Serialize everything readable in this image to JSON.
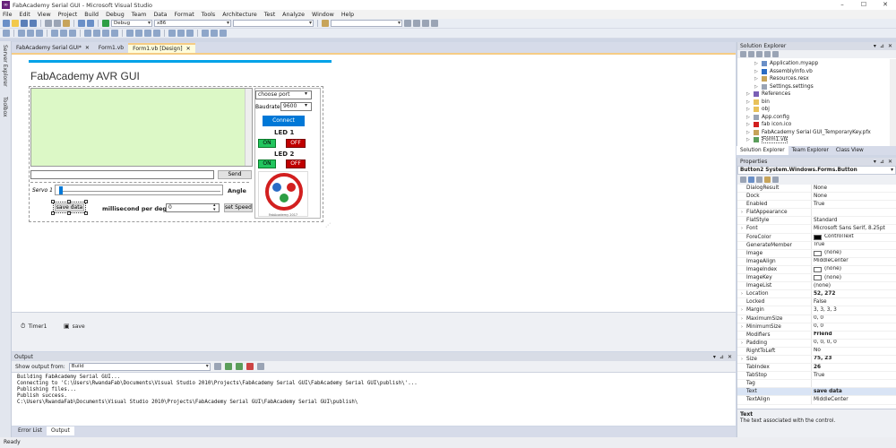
{
  "window": {
    "title": "FabAcademy Serial GUI - Microsoft Visual Studio"
  },
  "menu": [
    "File",
    "Edit",
    "View",
    "Project",
    "Build",
    "Debug",
    "Team",
    "Data",
    "Format",
    "Tools",
    "Architecture",
    "Test",
    "Analyze",
    "Window",
    "Help"
  ],
  "toolbar": {
    "config": "Debug",
    "platform": "x86"
  },
  "left_strip": {
    "server_explorer": "Server Explorer",
    "toolbox": "Toolbox"
  },
  "doc_tabs": [
    "FabAcademy Serial GUI*",
    "Form1.vb",
    "Form1.vb [Design]"
  ],
  "form": {
    "title": "FabAcademy AVR GUI",
    "port_combo": "choose port",
    "baud_label": "Baudrate",
    "baud_value": "9600",
    "connect": "Connect",
    "led1": "LED 1",
    "led2": "LED 2",
    "on": "ON",
    "off": "OFF",
    "send": "Send",
    "servo_label": "Servo 1",
    "angle_label": "Angle",
    "save_data": "save data",
    "ms_label": "millisecond per degree",
    "ms_value": "0",
    "set_speed": "set Speed",
    "logo_text": "FabAcademy 2017"
  },
  "colors": {
    "accent": "#00a2e8",
    "rich_text": "#dcf8c6",
    "connect": "#0078d7",
    "on": "#22c55e",
    "off": "#c00000"
  },
  "tray": [
    "Timer1",
    "save"
  ],
  "output": {
    "header": "Output",
    "show_from_label": "Show output from:",
    "source": "Build",
    "lines": [
      "Building FabAcademy Serial GUI...",
      "Connecting to 'C:\\Users\\RwandaFab\\Documents\\Visual Studio 2010\\Projects\\FabAcademy Serial GUI\\FabAcademy Serial GUI\\publish\\'...",
      "Publishing files...",
      "Publish success.",
      "C:\\Users\\RwandaFab\\Documents\\Visual Studio 2010\\Projects\\FabAcademy Serial GUI\\FabAcademy Serial GUI\\publish\\"
    ]
  },
  "bottom_tabs": [
    "Error List",
    "Output"
  ],
  "status": "Ready",
  "solution_explorer": {
    "header": "Solution Explorer",
    "items": [
      {
        "label": "Application.myapp",
        "level": 3,
        "icon": "app"
      },
      {
        "label": "AssemblyInfo.vb",
        "level": 3,
        "icon": "vb"
      },
      {
        "label": "Resources.resx",
        "level": 3,
        "icon": "res"
      },
      {
        "label": "Settings.settings",
        "level": 3,
        "icon": "set"
      },
      {
        "label": "References",
        "level": 2,
        "icon": "ref"
      },
      {
        "label": "bin",
        "level": 2,
        "icon": "folder"
      },
      {
        "label": "obj",
        "level": 2,
        "icon": "folder"
      },
      {
        "label": "App.config",
        "level": 2,
        "icon": "config"
      },
      {
        "label": "fab icon.ico",
        "level": 2,
        "icon": "ico"
      },
      {
        "label": "FabAcademy Serial GUI_TemporaryKey.pfx",
        "level": 2,
        "icon": "key"
      },
      {
        "label": "Form1.vb",
        "level": 2,
        "icon": "form"
      }
    ],
    "tabs": [
      "Solution Explorer",
      "Team Explorer",
      "Class View"
    ]
  },
  "properties": {
    "header": "Properties",
    "object": "Button2 System.Windows.Forms.Button",
    "rows": [
      {
        "name": "DialogResult",
        "value": "None"
      },
      {
        "name": "Dock",
        "value": "None"
      },
      {
        "name": "Enabled",
        "value": "True"
      },
      {
        "name": "FlatAppearance",
        "value": "",
        "exp": true
      },
      {
        "name": "FlatStyle",
        "value": "Standard"
      },
      {
        "name": "Font",
        "value": "Microsoft Sans Serif, 8.25pt",
        "exp": true
      },
      {
        "name": "ForeColor",
        "value": "ControlText",
        "swatch": "#000000"
      },
      {
        "name": "GenerateMember",
        "value": "True"
      },
      {
        "name": "Image",
        "value": "(none)",
        "swatch": "#ffffff"
      },
      {
        "name": "ImageAlign",
        "value": "MiddleCenter"
      },
      {
        "name": "ImageIndex",
        "value": "(none)",
        "swatch": "#ffffff"
      },
      {
        "name": "ImageKey",
        "value": "(none)",
        "swatch": "#ffffff"
      },
      {
        "name": "ImageList",
        "value": "(none)"
      },
      {
        "name": "Location",
        "value": "52, 272",
        "bold": true,
        "exp": true
      },
      {
        "name": "Locked",
        "value": "False"
      },
      {
        "name": "Margin",
        "value": "3, 3, 3, 3",
        "exp": true
      },
      {
        "name": "MaximumSize",
        "value": "0, 0",
        "exp": true
      },
      {
        "name": "MinimumSize",
        "value": "0, 0",
        "exp": true
      },
      {
        "name": "Modifiers",
        "value": "Friend",
        "bold": true
      },
      {
        "name": "Padding",
        "value": "0, 0, 0, 0",
        "exp": true
      },
      {
        "name": "RightToLeft",
        "value": "No"
      },
      {
        "name": "Size",
        "value": "75, 23",
        "bold": true,
        "exp": true
      },
      {
        "name": "TabIndex",
        "value": "26",
        "bold": true
      },
      {
        "name": "TabStop",
        "value": "True"
      },
      {
        "name": "Tag",
        "value": ""
      },
      {
        "name": "Text",
        "value": "save data",
        "bold": true,
        "sel": true
      },
      {
        "name": "TextAlign",
        "value": "MiddleCenter"
      }
    ],
    "desc_title": "Text",
    "desc_body": "The text associated with the control."
  }
}
